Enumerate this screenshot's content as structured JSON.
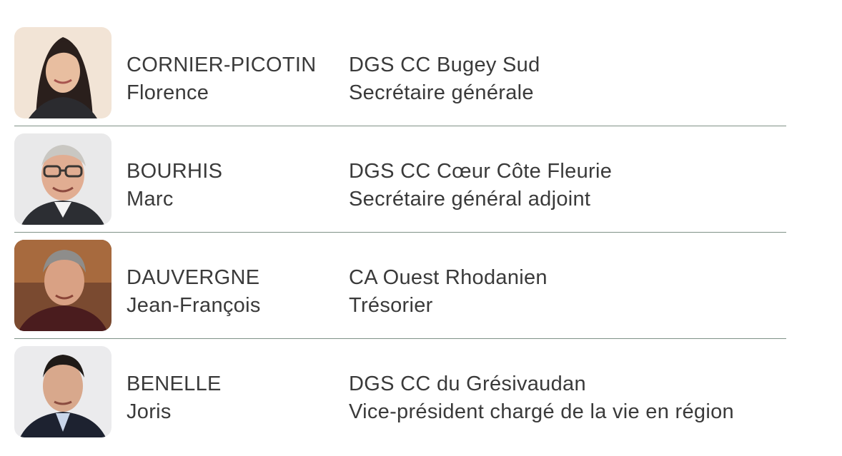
{
  "members": [
    {
      "last_name": "CORNIER-PICOTIN",
      "first_name": "Florence",
      "organization": "DGS CC Bugey Sud",
      "title": "Secrétaire générale"
    },
    {
      "last_name": "BOURHIS",
      "first_name": "Marc",
      "organization": "DGS CC Cœur Côte Fleurie",
      "title": "Secrétaire général adjoint"
    },
    {
      "last_name": "DAUVERGNE",
      "first_name": "Jean-François",
      "organization": "CA Ouest Rhodanien",
      "title": "Trésorier"
    },
    {
      "last_name": "BENELLE",
      "first_name": "Joris",
      "organization": "DGS CC du Grésivaudan",
      "title": "Vice-président chargé de la vie en région"
    }
  ],
  "colors": {
    "divider": "#7f9187",
    "text": "#3a3a3a"
  }
}
